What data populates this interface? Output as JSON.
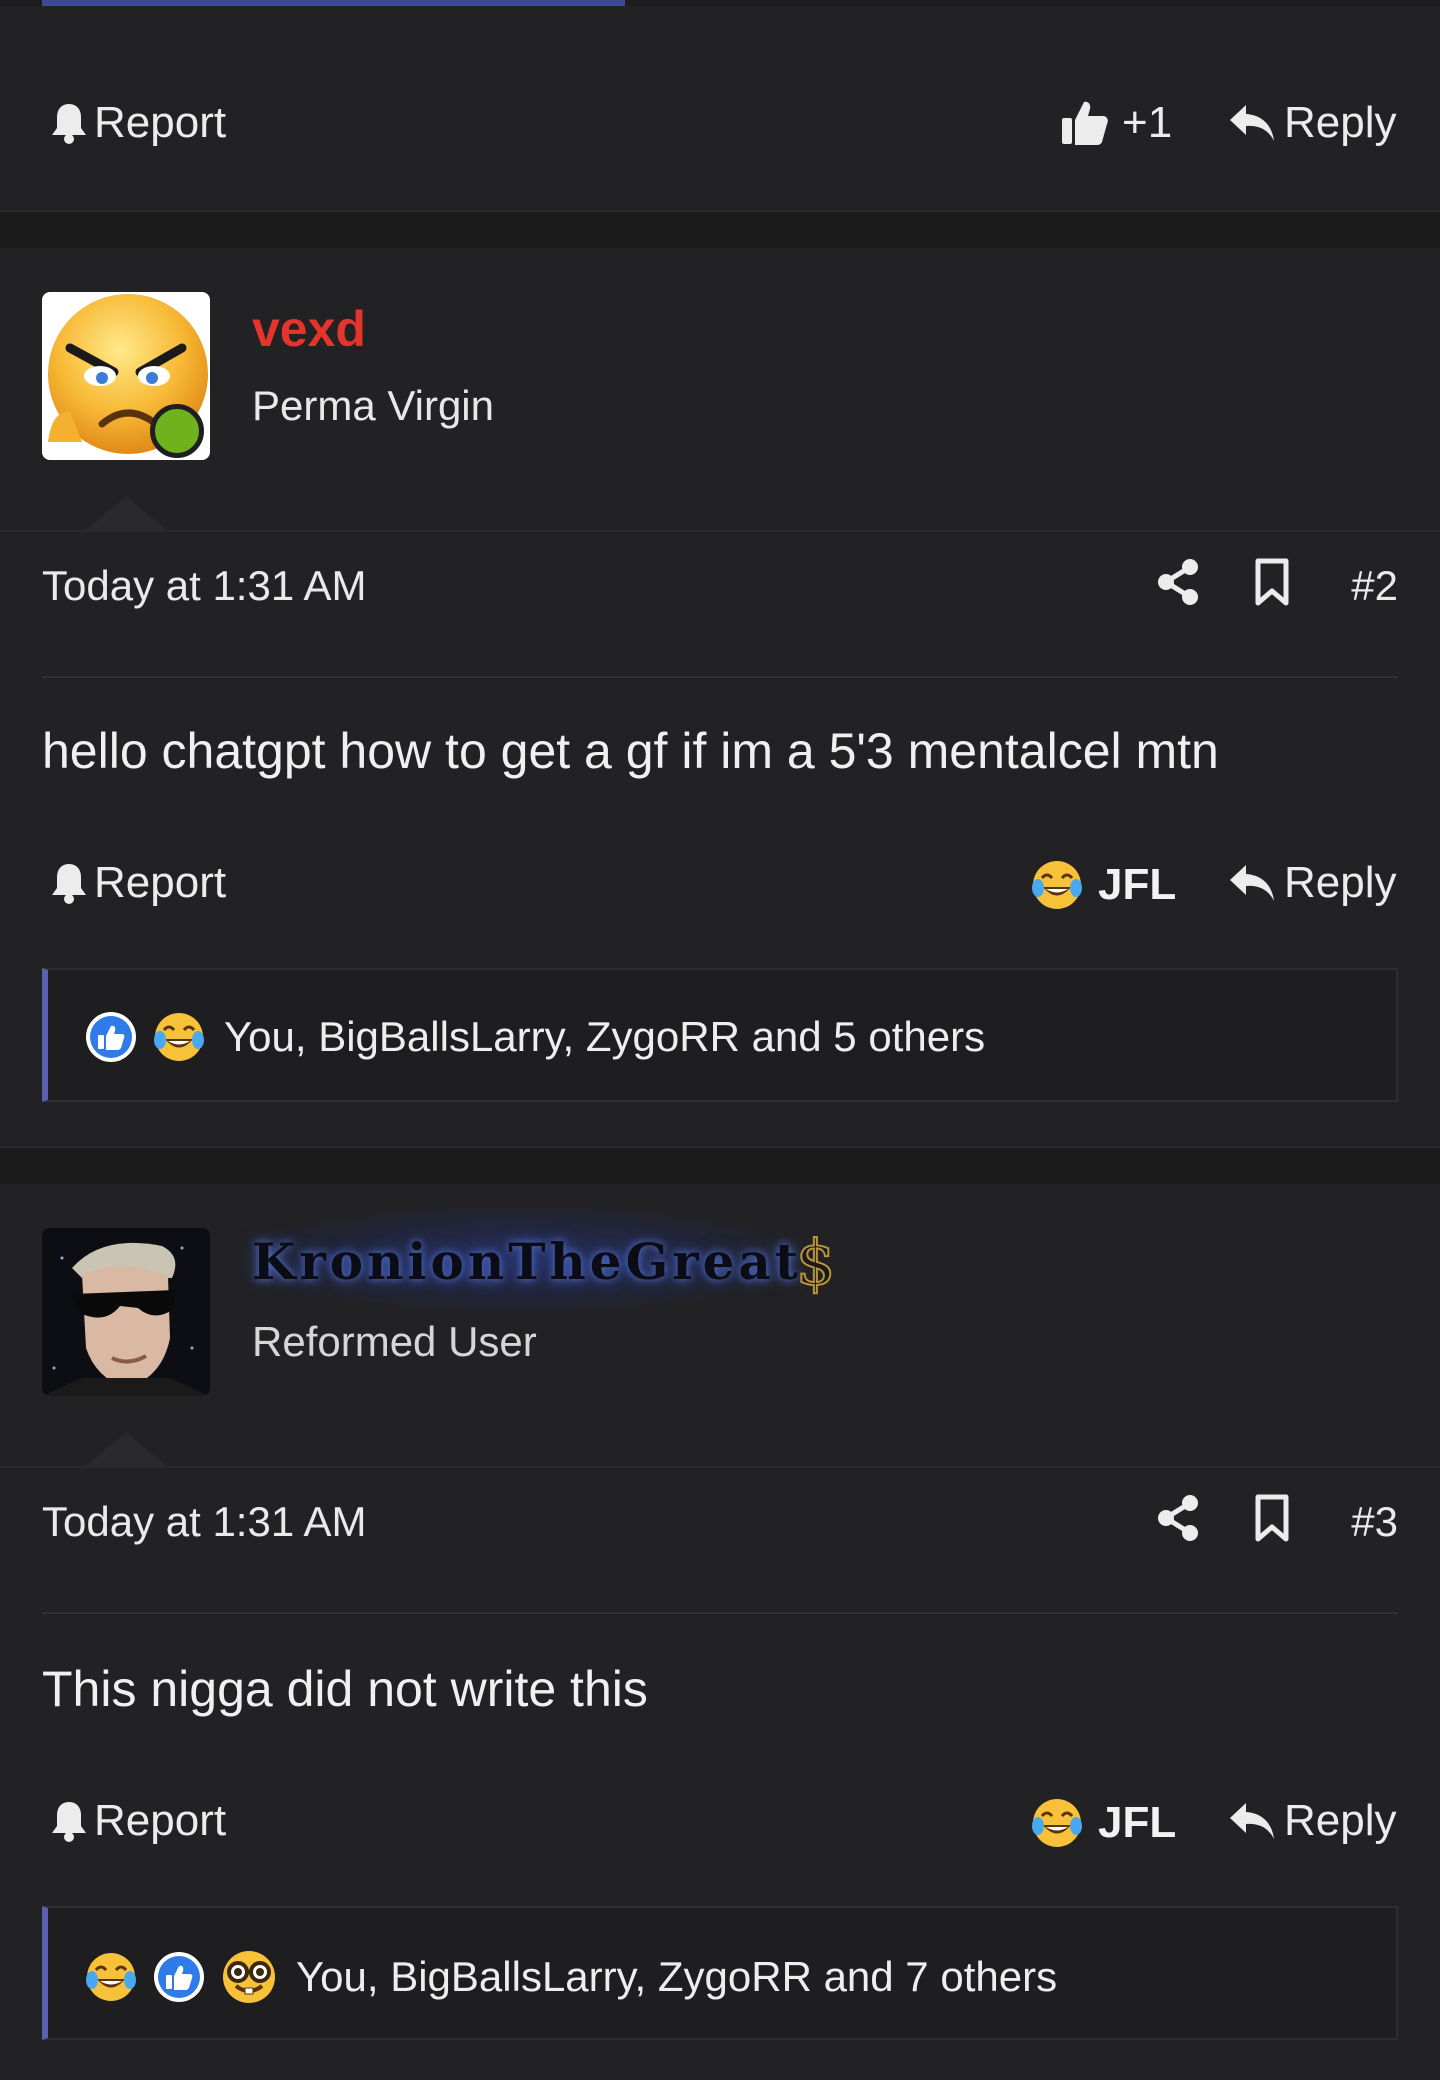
{
  "colors": {
    "background": "#1d1d1f",
    "post_background": "#222224",
    "accent_bar": "#5a5fb0",
    "username_red": "#e5342b",
    "online": "#6fb21e",
    "gold": "#b8943a"
  },
  "prev_post_actions": {
    "report_label": "Report",
    "reaction_label": "+1",
    "reply_label": "Reply"
  },
  "posts": [
    {
      "username": "vexd",
      "user_title": "Perma Virgin",
      "avatar_icon": "angry-emoji-avatar",
      "online": true,
      "date": "Today at 1:31 AM",
      "post_number": "#2",
      "body": "hello chatgpt how to get a gf if im a 5'3 mentalcel mtn",
      "actions": {
        "report_label": "Report",
        "reaction_label": "JFL",
        "reply_label": "Reply"
      },
      "reactions": {
        "icons": [
          "thumbs-up-icon",
          "crying-laughing-icon"
        ],
        "summary": "You, BigBallsLarry, ZygoRR and 5 others"
      }
    },
    {
      "username": "KronionTheGreat",
      "badge": "$",
      "user_title": "Reformed User",
      "avatar_icon": "sunglasses-man-avatar",
      "online": false,
      "date": "Today at 1:31 AM",
      "post_number": "#3",
      "body": "This nigga did not write this",
      "actions": {
        "report_label": "Report",
        "reaction_label": "JFL",
        "reply_label": "Reply"
      },
      "reactions": {
        "icons": [
          "crying-laughing-icon",
          "thumbs-up-icon",
          "nerd-face-icon"
        ],
        "summary": "You, BigBallsLarry, ZygoRR and 7 others"
      }
    }
  ]
}
